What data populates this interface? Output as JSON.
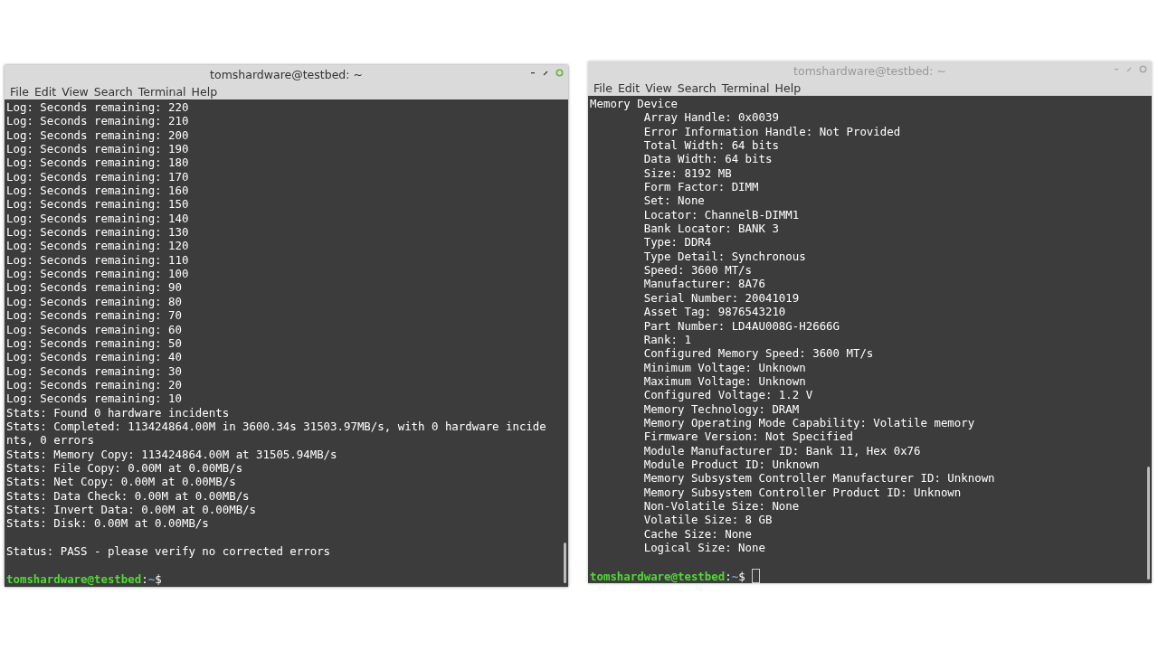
{
  "windows": [
    {
      "title": "tomshardware@testbed: ~",
      "active": true,
      "menu": [
        "File",
        "Edit",
        "View",
        "Search",
        "Terminal",
        "Help"
      ],
      "lines": [
        {
          "text": "Log: Seconds remaining: 220"
        },
        {
          "text": "Log: Seconds remaining: 210"
        },
        {
          "text": "Log: Seconds remaining: 200"
        },
        {
          "text": "Log: Seconds remaining: 190"
        },
        {
          "text": "Log: Seconds remaining: 180"
        },
        {
          "text": "Log: Seconds remaining: 170"
        },
        {
          "text": "Log: Seconds remaining: 160"
        },
        {
          "text": "Log: Seconds remaining: 150"
        },
        {
          "text": "Log: Seconds remaining: 140"
        },
        {
          "text": "Log: Seconds remaining: 130"
        },
        {
          "text": "Log: Seconds remaining: 120"
        },
        {
          "text": "Log: Seconds remaining: 110"
        },
        {
          "text": "Log: Seconds remaining: 100"
        },
        {
          "text": "Log: Seconds remaining: 90"
        },
        {
          "text": "Log: Seconds remaining: 80"
        },
        {
          "text": "Log: Seconds remaining: 70"
        },
        {
          "text": "Log: Seconds remaining: 60"
        },
        {
          "text": "Log: Seconds remaining: 50"
        },
        {
          "text": "Log: Seconds remaining: 40"
        },
        {
          "text": "Log: Seconds remaining: 30"
        },
        {
          "text": "Log: Seconds remaining: 20"
        },
        {
          "text": "Log: Seconds remaining: 10"
        },
        {
          "text": "Stats: Found 0 hardware incidents"
        },
        {
          "text": "Stats: Completed: 113424864.00M in 3600.34s 31503.97MB/s, with 0 hardware incide"
        },
        {
          "text": "nts, 0 errors"
        },
        {
          "text": "Stats: Memory Copy: 113424864.00M at 31505.94MB/s"
        },
        {
          "text": "Stats: File Copy: 0.00M at 0.00MB/s"
        },
        {
          "text": "Stats: Net Copy: 0.00M at 0.00MB/s"
        },
        {
          "text": "Stats: Data Check: 0.00M at 0.00MB/s"
        },
        {
          "text": "Stats: Invert Data: 0.00M at 0.00MB/s"
        },
        {
          "text": "Stats: Disk: 0.00M at 0.00MB/s"
        },
        {
          "kind": "blank"
        },
        {
          "text": "Status: PASS - please verify no corrected errors"
        },
        {
          "kind": "blank"
        }
      ],
      "prompt": {
        "user_host": "tomshardware@testbed",
        "separator": ":",
        "path": "~",
        "symbol": "$"
      },
      "cursor": false
    },
    {
      "title": "tomshardware@testbed: ~",
      "active": false,
      "menu": [
        "File",
        "Edit",
        "View",
        "Search",
        "Terminal",
        "Help"
      ],
      "lines": [
        {
          "text": "Memory Device"
        },
        {
          "text": "Array Handle: 0x0039",
          "indent": true
        },
        {
          "text": "Error Information Handle: Not Provided",
          "indent": true
        },
        {
          "text": "Total Width: 64 bits",
          "indent": true
        },
        {
          "text": "Data Width: 64 bits",
          "indent": true
        },
        {
          "text": "Size: 8192 MB",
          "indent": true
        },
        {
          "text": "Form Factor: DIMM",
          "indent": true
        },
        {
          "text": "Set: None",
          "indent": true
        },
        {
          "text": "Locator: ChannelB-DIMM1",
          "indent": true
        },
        {
          "text": "Bank Locator: BANK 3",
          "indent": true
        },
        {
          "text": "Type: DDR4",
          "indent": true
        },
        {
          "text": "Type Detail: Synchronous",
          "indent": true
        },
        {
          "text": "Speed: 3600 MT/s",
          "indent": true
        },
        {
          "text": "Manufacturer: 8A76",
          "indent": true
        },
        {
          "text": "Serial Number: 20041019",
          "indent": true
        },
        {
          "text": "Asset Tag: 9876543210",
          "indent": true
        },
        {
          "text": "Part Number: LD4AU008G-H2666G",
          "indent": true
        },
        {
          "text": "Rank: 1",
          "indent": true
        },
        {
          "text": "Configured Memory Speed: 3600 MT/s",
          "indent": true
        },
        {
          "text": "Minimum Voltage: Unknown",
          "indent": true
        },
        {
          "text": "Maximum Voltage: Unknown",
          "indent": true
        },
        {
          "text": "Configured Voltage: 1.2 V",
          "indent": true
        },
        {
          "text": "Memory Technology: DRAM",
          "indent": true
        },
        {
          "text": "Memory Operating Mode Capability: Volatile memory",
          "indent": true
        },
        {
          "text": "Firmware Version: Not Specified",
          "indent": true
        },
        {
          "text": "Module Manufacturer ID: Bank 11, Hex 0x76",
          "indent": true
        },
        {
          "text": "Module Product ID: Unknown",
          "indent": true
        },
        {
          "text": "Memory Subsystem Controller Manufacturer ID: Unknown",
          "indent": true
        },
        {
          "text": "Memory Subsystem Controller Product ID: Unknown",
          "indent": true
        },
        {
          "text": "Non-Volatile Size: None",
          "indent": true
        },
        {
          "text": "Volatile Size: 8 GB",
          "indent": true
        },
        {
          "text": "Cache Size: None",
          "indent": true
        },
        {
          "text": "Logical Size: None",
          "indent": true
        },
        {
          "kind": "blank"
        }
      ],
      "prompt": {
        "user_host": "tomshardware@testbed",
        "separator": ":",
        "path": "~",
        "symbol": "$"
      },
      "cursor": true
    }
  ]
}
